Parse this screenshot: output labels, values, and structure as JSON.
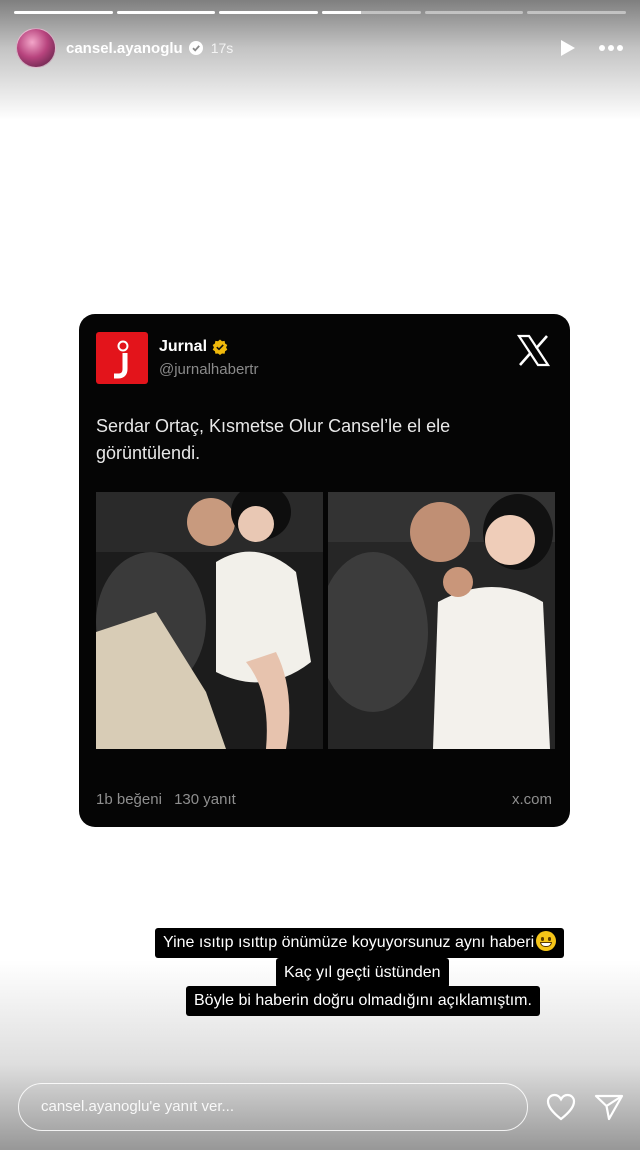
{
  "story": {
    "progress_segments": [
      1,
      1,
      1,
      0.4,
      0,
      0
    ],
    "username": "cansel.ayanoglu",
    "time_ago": "17s",
    "icons": [
      "verified-badge-icon",
      "play-icon",
      "more-icon"
    ]
  },
  "tweet": {
    "account_name": "Jurnal",
    "handle": "@jurnalhabertr",
    "logo_letter": "j",
    "text": "Serdar Ortaç, Kısmetse Olur Cansel’le el ele görüntülendi.",
    "likes": "1b beğeni",
    "replies": "130 yanıt",
    "domain": "x.com",
    "icons": [
      "jurnal-logo-icon",
      "verified-gold-icon",
      "x-logo-icon"
    ],
    "colors": {
      "logo": "#e3141b",
      "verified": "#f0b90b",
      "card": "#050505"
    }
  },
  "captions": {
    "line1": "Yine ısıtıp ısıttıp önümüze koyuyorsunuz aynı haberi",
    "line2": "Kaç yıl geçti üstünden",
    "line3": "Böyle bi haberin doğru olmadığını açıklamıştım."
  },
  "footer": {
    "reply_placeholder": "cansel.ayanoglu'e yanıt ver...",
    "icons": [
      "heart-icon",
      "send-icon"
    ]
  }
}
